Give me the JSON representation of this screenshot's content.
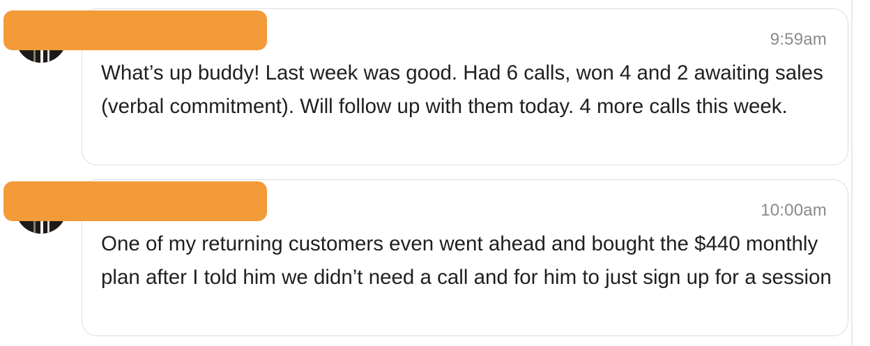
{
  "messages": [
    {
      "time": "9:59am",
      "text": "What’s up buddy! Last week was good. Had 6 calls, won 4 and 2 awaiting sales (verbal commitment). Will follow up with them today. 4 more calls this week."
    },
    {
      "time": "10:00am",
      "text": "One of my returning customers even went ahead and bought the $440 monthly plan after I told him we didn’t need a call and for him to just sign up for a session"
    }
  ],
  "colors": {
    "redaction": "#f29b38",
    "bubble_border": "#dcdcdc",
    "timestamp": "#8a8a8a",
    "text": "#1f1f1f"
  }
}
